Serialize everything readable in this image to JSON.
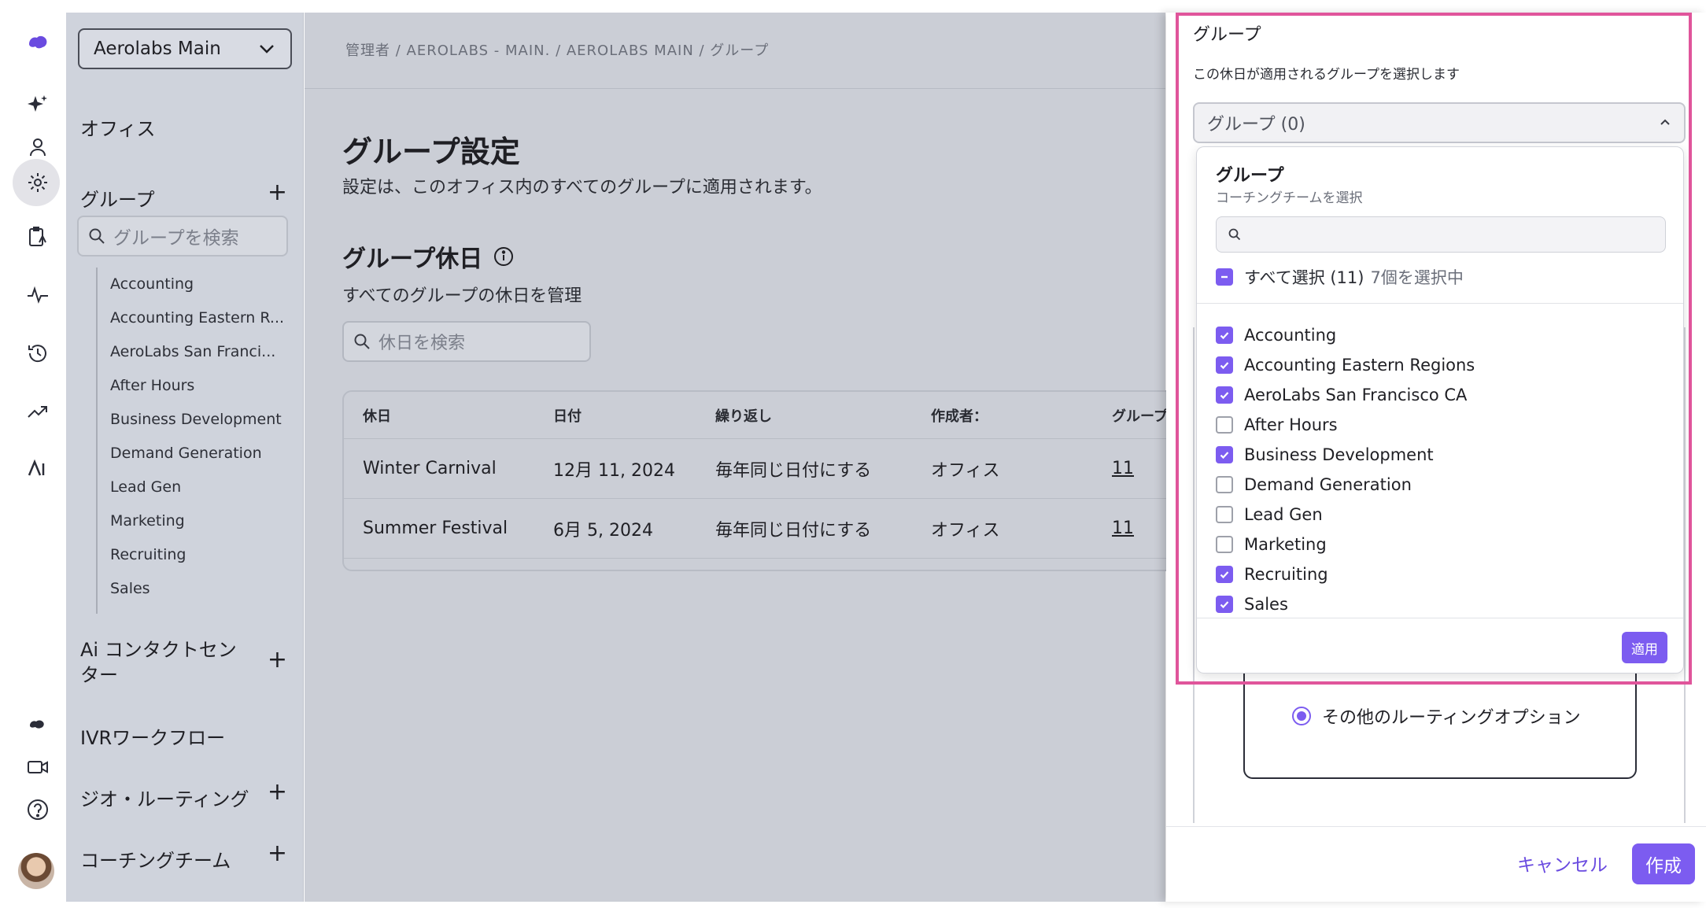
{
  "rail": {
    "icons": [
      "logo-icon",
      "sparkle-icon",
      "user-icon",
      "gear-icon",
      "clipboard-icon",
      "activity-icon",
      "history-icon",
      "trend-icon",
      "ai-icon",
      "brand-mark-icon",
      "video-icon",
      "help-icon"
    ]
  },
  "sidebar": {
    "workspace": "Aerolabs Main",
    "office": "オフィス",
    "groups_label": "グループ",
    "groups_search_placeholder": "グループを検索",
    "groups": [
      "Accounting",
      "Accounting Eastern R...",
      "AeroLabs San Franci...",
      "After Hours",
      "Business Development",
      "Demand Generation",
      "Lead Gen",
      "Marketing",
      "Recruiting",
      "Sales"
    ],
    "ai_contact_center": "Ai コンタクトセンター",
    "ivr": "IVRワークフロー",
    "geo_routing": "ジオ・ルーティング",
    "coaching": "コーチングチーム"
  },
  "main": {
    "breadcrumb": "管理者 / AEROLABS - MAIN. / AEROLABS MAIN / グループ",
    "title": "グループ設定",
    "subtitle": "設定は、このオフィス内のすべてのグループに適用されます。",
    "holiday_title": "グループ休日",
    "holiday_sub": "すべてのグループの休日を管理",
    "holiday_search_placeholder": "休日を検索",
    "columns": [
      "休日",
      "日付",
      "繰り返し",
      "作成者：",
      "グループ"
    ],
    "rows": [
      {
        "name": "Winter Carnival",
        "date": "12月 11, 2024",
        "repeat": "毎年同じ日付にする",
        "creator": "オフィス",
        "groups": "11"
      },
      {
        "name": "Summer Festival",
        "date": "6月 5, 2024",
        "repeat": "毎年同じ日付にする",
        "creator": "オフィス",
        "groups": "11"
      }
    ]
  },
  "panel": {
    "title": "グループ",
    "desc": "この休日が適用されるグループを選択します",
    "trigger": "グループ (0)",
    "dd_title": "グループ",
    "dd_sub": "コーチングチームを選択",
    "select_all": "すべて選択 (11)",
    "selected_count": "7個を選択中",
    "options": [
      {
        "label": "Accounting",
        "checked": true
      },
      {
        "label": "Accounting Eastern Regions",
        "checked": true
      },
      {
        "label": "AeroLabs San Francisco CA",
        "checked": true
      },
      {
        "label": "After Hours",
        "checked": false
      },
      {
        "label": "Business Development",
        "checked": true
      },
      {
        "label": "Demand Generation",
        "checked": false
      },
      {
        "label": "Lead Gen",
        "checked": false
      },
      {
        "label": "Marketing",
        "checked": false
      },
      {
        "label": "Recruiting",
        "checked": true
      },
      {
        "label": "Sales",
        "checked": true
      }
    ],
    "apply": "適用",
    "routing_option": "その他のルーティングオプション",
    "cancel": "キャンセル",
    "create": "作成"
  },
  "colors": {
    "accent": "#7c5cf0",
    "highlight": "#e0559b"
  }
}
